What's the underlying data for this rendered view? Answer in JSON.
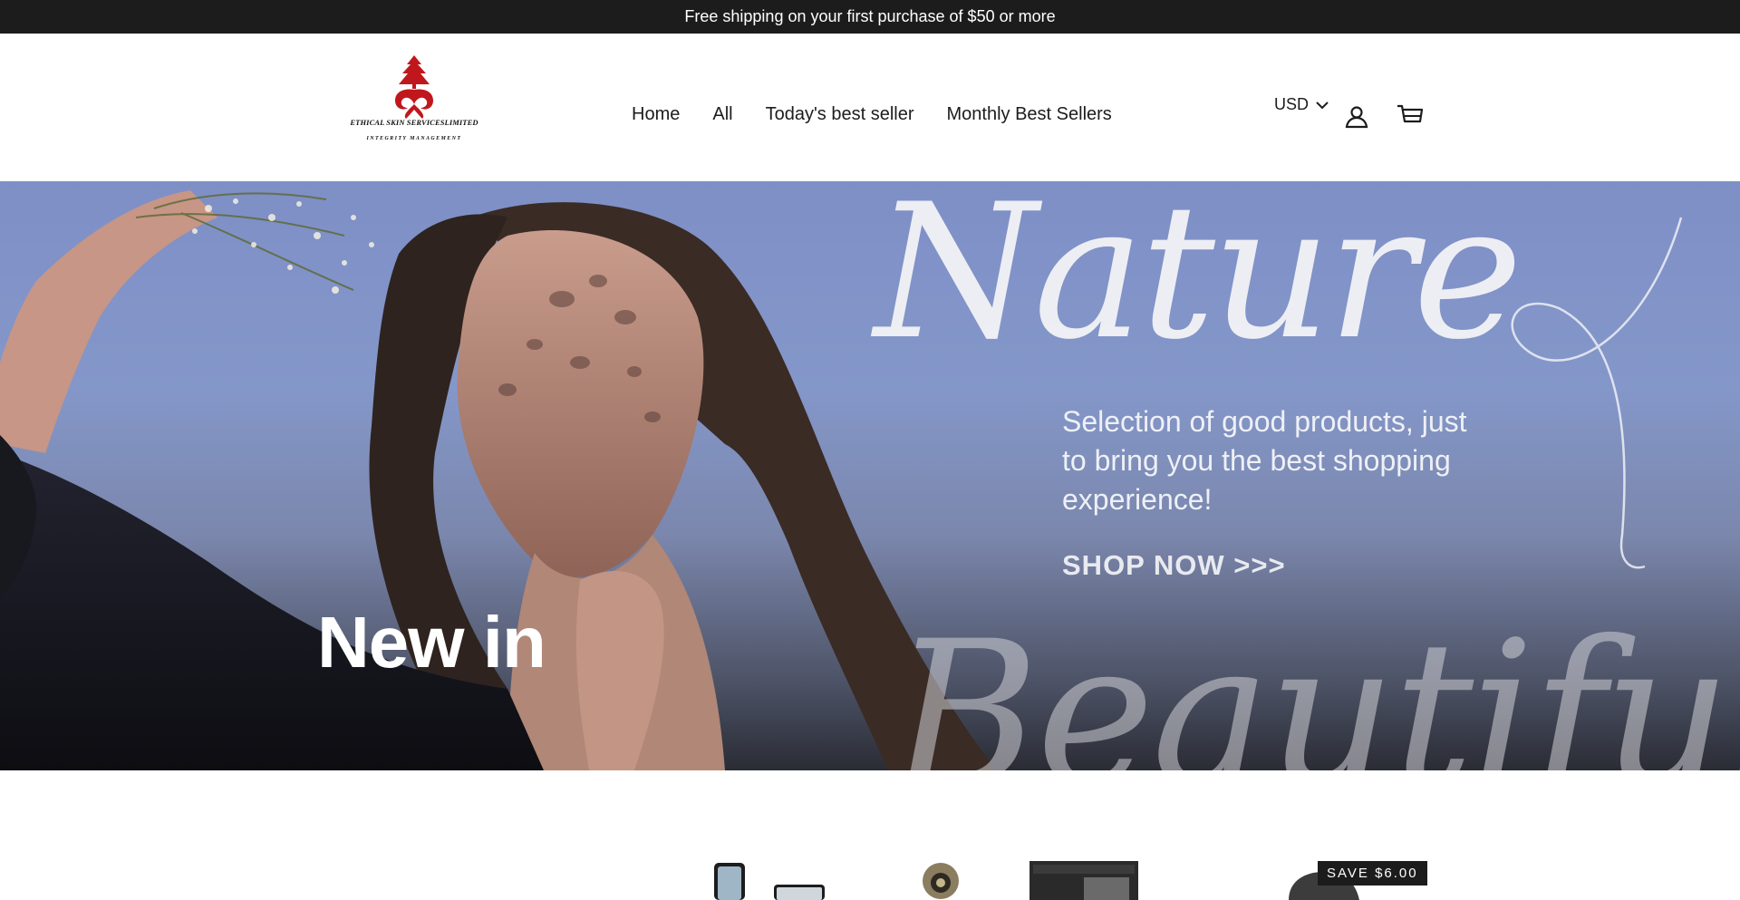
{
  "announcement": "Free shipping on your first purchase of $50 or more",
  "logo": {
    "name": "ETHICAL SKIN SERVICESLIMITED",
    "tagline": "INTEGRITY MANAGEMENT",
    "color": "#c0171d"
  },
  "nav": [
    "Home",
    "All",
    "Today's best seller",
    "Monthly Best Sellers"
  ],
  "currency": {
    "selected": "USD",
    "icon": "chevron-down-icon"
  },
  "header_icons": [
    "account-icon",
    "cart-icon"
  ],
  "hero": {
    "heading": "New in",
    "script_top": "Nature",
    "script_bottom": "Beautiful",
    "body": "Selection of good products, just to bring you the best shopping experience!",
    "cta": "SHOP NOW >>>"
  },
  "product_badge": "SAVE $6.00",
  "colors": {
    "announcement_bg": "#1c1c1c",
    "hero_sky": "#7e8fc6"
  }
}
